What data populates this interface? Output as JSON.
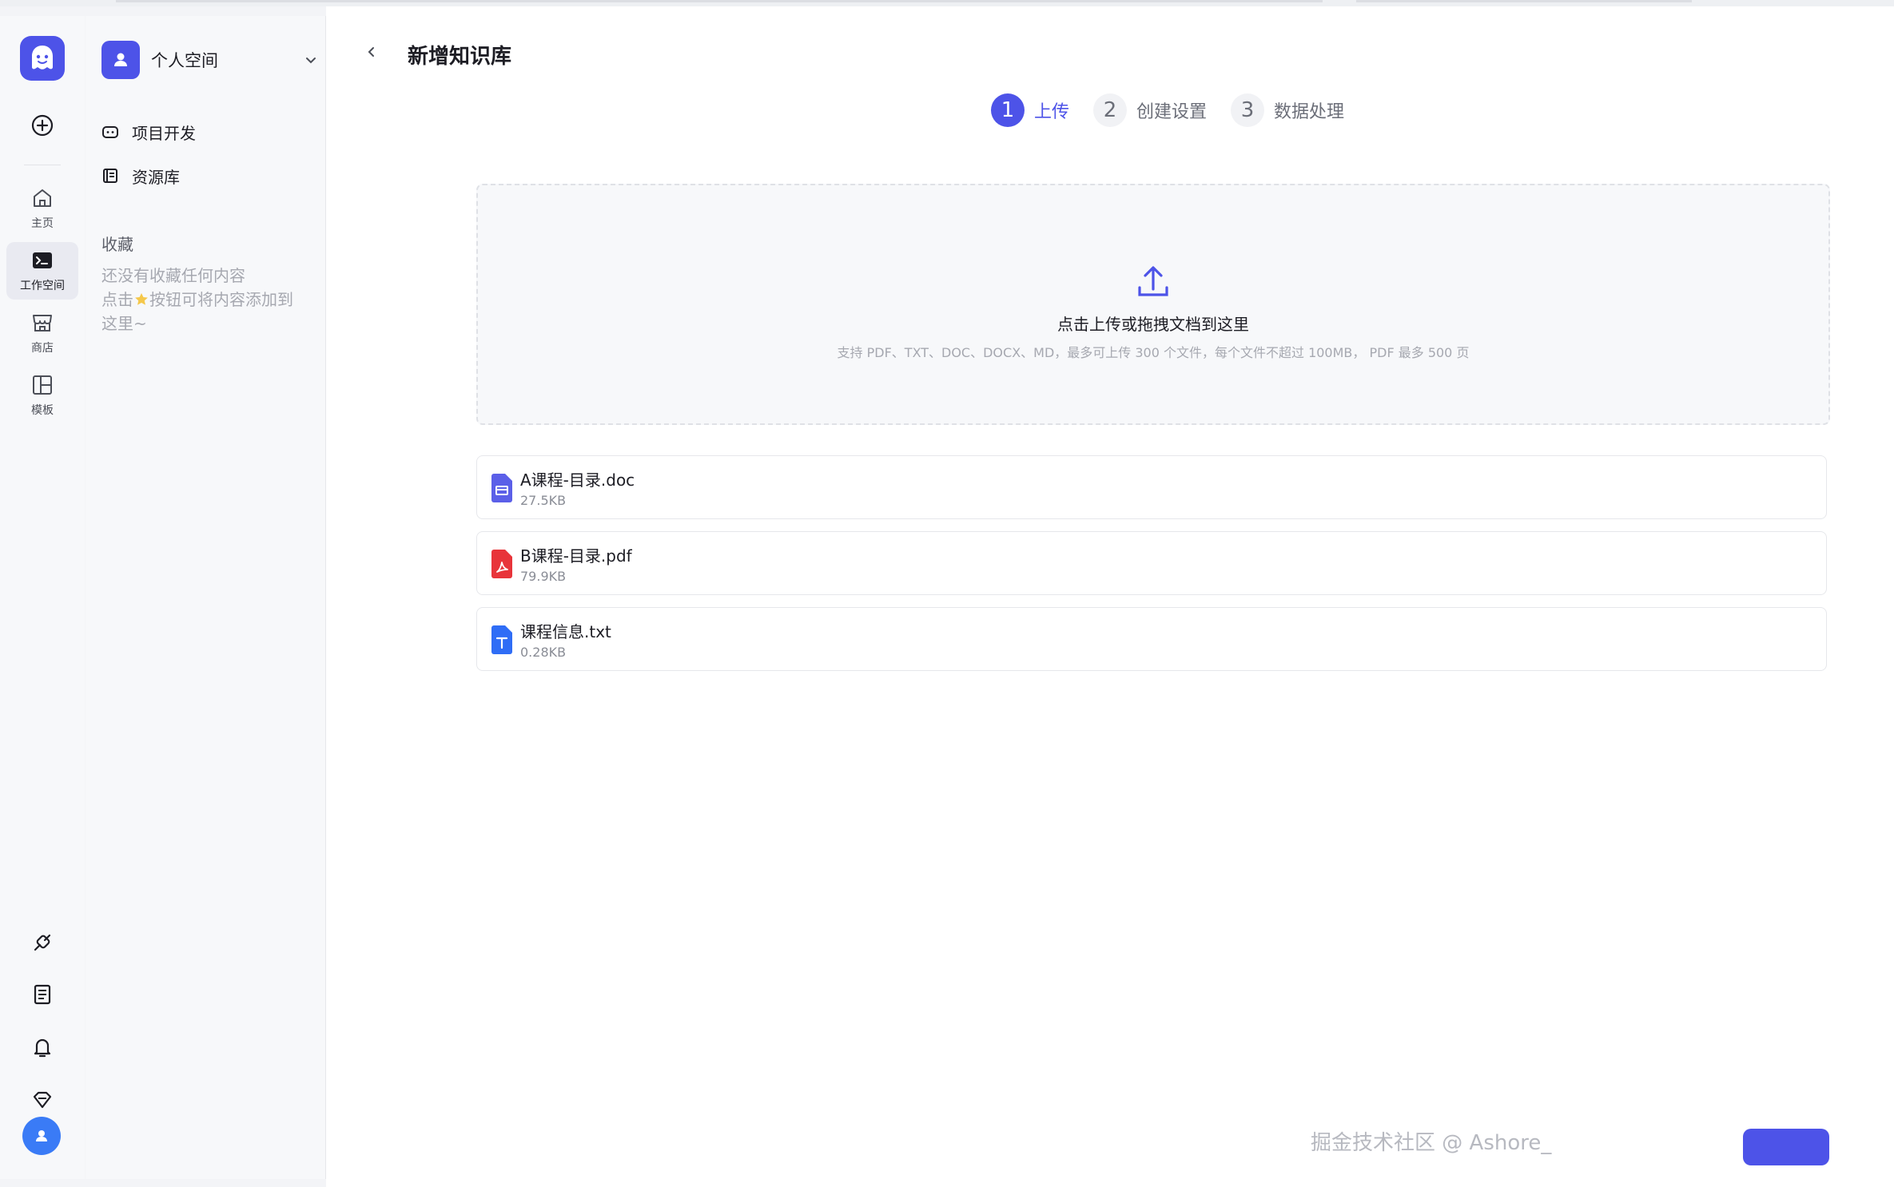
{
  "rail": {
    "nav": [
      {
        "label": "主页",
        "icon": "home-icon"
      },
      {
        "label": "工作空间",
        "icon": "terminal-icon",
        "active": true
      },
      {
        "label": "商店",
        "icon": "store-icon"
      },
      {
        "label": "模板",
        "icon": "layout-icon"
      }
    ]
  },
  "sidebar": {
    "space_name": "个人空间",
    "items": [
      {
        "label": "项目开发",
        "icon": "bot-icon"
      },
      {
        "label": "资源库",
        "icon": "library-icon"
      }
    ],
    "favorites_title": "收藏",
    "favorites_empty_line1": "还没有收藏任何内容",
    "favorites_empty_line2_a": "点击",
    "favorites_empty_line2_b": "按钮可将内容添加到",
    "favorites_empty_line3": "这里~"
  },
  "main": {
    "title": "新增知识库",
    "steps": [
      {
        "num": "1",
        "label": "上传",
        "active": true
      },
      {
        "num": "2",
        "label": "创建设置",
        "active": false
      },
      {
        "num": "3",
        "label": "数据处理",
        "active": false
      }
    ],
    "dropzone": {
      "title": "点击上传或拖拽文档到这里",
      "hint": "支持 PDF、TXT、DOC、DOCX、MD，最多可上传 300 个文件，每个文件不超过 100MB， PDF 最多 500 页"
    },
    "files": [
      {
        "name": "A课程-目录.doc",
        "size": "27.5KB",
        "type": "doc"
      },
      {
        "name": "B课程-目录.pdf",
        "size": "79.9KB",
        "type": "pdf"
      },
      {
        "name": "课程信息.txt",
        "size": "0.28KB",
        "type": "txt"
      }
    ]
  },
  "watermark": "掘金技术社区 @ Ashore_",
  "colors": {
    "accent": "#4d53e8",
    "pdf": "#e8343a",
    "txt": "#2f6df6",
    "doc": "#5b5fe8"
  }
}
